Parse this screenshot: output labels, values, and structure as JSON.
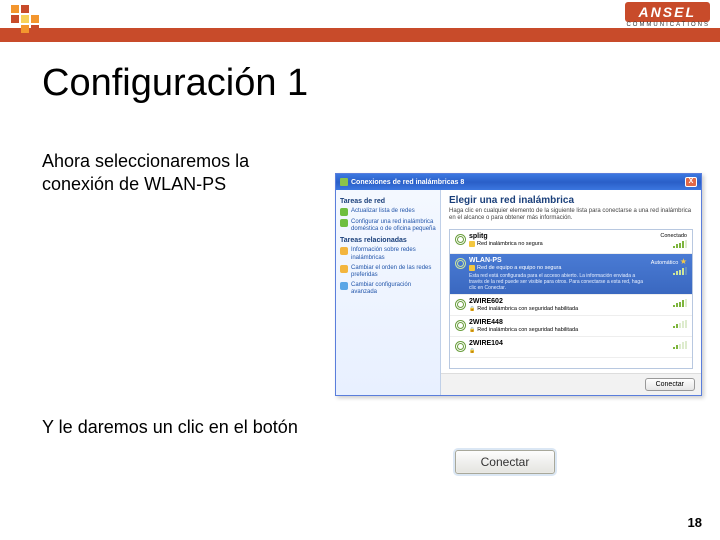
{
  "brand": {
    "name": "ANSEL",
    "sub": "COMMUNICATIONS"
  },
  "slide": {
    "title": "Configuración 1",
    "text1": "Ahora seleccionaremos la conexión de WLAN-PS",
    "text2": "Y le daremos un clic en el botón",
    "page": "18"
  },
  "xp": {
    "title": "Conexiones de red inalámbricas 8",
    "close": "X",
    "sidebar": {
      "section1": "Tareas de red",
      "items1": [
        {
          "label": "Actualizar lista de redes",
          "color": "#6fbf3f"
        },
        {
          "label": "Configurar una red inalámbrica doméstica o de oficina pequeña",
          "color": "#6fbf3f"
        }
      ],
      "section2": "Tareas relacionadas",
      "items2": [
        {
          "label": "Información sobre redes inalámbricas",
          "color": "#f3b53e"
        },
        {
          "label": "Cambiar el orden de las redes preferidas",
          "color": "#f3b53e"
        },
        {
          "label": "Cambiar configuración avanzada",
          "color": "#5aa6e6"
        }
      ]
    },
    "main": {
      "title": "Elegir una red inalámbrica",
      "sub": "Haga clic en cualquier elemento de la siguiente lista para conectarse a una red inalámbrica en el alcance o para obtener más información.",
      "networks": [
        {
          "name": "splitg",
          "type": "Red inalámbrica no segura",
          "status": "Conectado",
          "selected": false,
          "bars": 4
        },
        {
          "name": "WLAN-PS",
          "type": "Red de equipo a equipo no segura",
          "status": "Automático",
          "selected": true,
          "bars": 4,
          "star": true,
          "desc": "Esta red está configurada para el acceso abierto. La información enviada a través de la red puede ser visible para otros. Para conectarse a esta red, haga clic en Conectar."
        },
        {
          "name": "2WIRE602",
          "type": "Red inalámbrica con seguridad habilitada",
          "selected": false,
          "bars": 4,
          "lock": true
        },
        {
          "name": "2WIRE448",
          "type": "Red inalámbrica con seguridad habilitada",
          "selected": false,
          "bars": 2,
          "lock": true
        },
        {
          "name": "2WIRE104",
          "type": "",
          "selected": false,
          "bars": 2,
          "lock": true
        }
      ],
      "footer_btn": "Conectar"
    }
  },
  "button": {
    "label": "Conectar"
  },
  "logo_colors": [
    "#f3962e",
    "#c84b2a",
    "#f8d15a",
    "#c84b2a",
    "#f3c740",
    "#f8d15a",
    "#f3962e",
    "#c84b2a"
  ]
}
